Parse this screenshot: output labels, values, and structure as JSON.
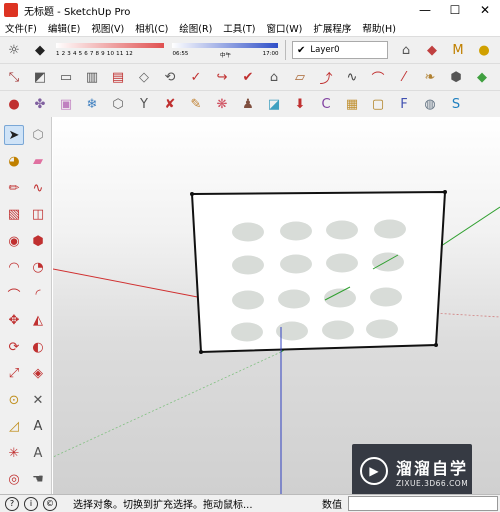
{
  "window": {
    "title": "无标题 - SketchUp Pro",
    "minimize": "—",
    "maximize": "☐",
    "close": "✕"
  },
  "menu": [
    "文件(F)",
    "编辑(E)",
    "视图(V)",
    "相机(C)",
    "绘图(R)",
    "工具(T)",
    "窗口(W)",
    "扩展程序",
    "帮助(H)"
  ],
  "shadow_settings": {
    "month_ticks": "1 2 3 4 5 6 7 8 9 10 11 12",
    "time_start": "06:55",
    "time_mid": "中午",
    "time_end": "17:00"
  },
  "layer": {
    "current": "Layer0",
    "check": "✔"
  },
  "toolbar_row1_icons": [
    {
      "name": "shadow-icon",
      "glyph": "☼",
      "color": "#333333"
    },
    {
      "name": "eraser-icon",
      "glyph": "◆",
      "color": "#222222"
    }
  ],
  "toolbar_row1_right_icons": [
    {
      "name": "warehouse-icon",
      "glyph": "⌂",
      "color": "#555555"
    },
    {
      "name": "share-model-icon",
      "glyph": "◆",
      "color": "#c04040"
    },
    {
      "name": "extension-warehouse-icon",
      "glyph": "M",
      "color": "#c08000"
    },
    {
      "name": "layout-icon",
      "glyph": "●",
      "color": "#d0a000"
    }
  ],
  "toolbar_row2_icons": [
    {
      "name": "move-vertex-icon",
      "glyph": "⤡",
      "color": "#a03030"
    },
    {
      "name": "push-face-icon",
      "glyph": "◩",
      "color": "#555555"
    },
    {
      "name": "offset-face-icon",
      "glyph": "▭",
      "color": "#555555"
    },
    {
      "name": "array-icon",
      "glyph": "▥",
      "color": "#555555"
    },
    {
      "name": "extrude-icon",
      "glyph": "▤",
      "color": "#c03030"
    },
    {
      "name": "slice-icon",
      "glyph": "◇",
      "color": "#666666"
    },
    {
      "name": "rotate-copy-icon",
      "glyph": "⟲",
      "color": "#555555"
    },
    {
      "name": "curve-icon",
      "glyph": "✓",
      "color": "#c03030"
    },
    {
      "name": "spline-icon",
      "glyph": "↪",
      "color": "#c03030"
    },
    {
      "name": "check-curve-icon",
      "glyph": "✔",
      "color": "#c03030"
    },
    {
      "name": "roof-icon",
      "glyph": "⌂",
      "color": "#555555"
    },
    {
      "name": "tape-icon",
      "glyph": "▱",
      "color": "#aa6633"
    },
    {
      "name": "bezier-icon",
      "glyph": "⤴",
      "color": "#c03030"
    },
    {
      "name": "polyline-icon",
      "glyph": "∿",
      "color": "#444444"
    },
    {
      "name": "arc-tool-icon",
      "glyph": "⌒",
      "color": "#c03030"
    },
    {
      "name": "divide-icon",
      "glyph": "⁄",
      "color": "#c03030"
    },
    {
      "name": "leaf-icon",
      "glyph": "❧",
      "color": "#b08030"
    },
    {
      "name": "solid-icon",
      "glyph": "⬢",
      "color": "#555555"
    },
    {
      "name": "terrain-icon",
      "glyph": "◆",
      "color": "#40a040"
    },
    {
      "name": "hand-icon",
      "glyph": "☚",
      "color": "#555555"
    }
  ],
  "toolbar_row3_icons": [
    {
      "name": "paint-red-icon",
      "glyph": "●",
      "color": "#c03030"
    },
    {
      "name": "molecule-icon",
      "glyph": "✤",
      "color": "#8060a0"
    },
    {
      "name": "cube-icon",
      "glyph": "▣",
      "color": "#c080c0"
    },
    {
      "name": "snowflake-icon",
      "glyph": "❄",
      "color": "#4080c0"
    },
    {
      "name": "wire-cube-icon",
      "glyph": "⬡",
      "color": "#666666"
    },
    {
      "name": "y-branch-icon",
      "glyph": "Y",
      "color": "#555555"
    },
    {
      "name": "cross-tool-icon",
      "glyph": "✘",
      "color": "#c03030"
    },
    {
      "name": "brush-icon",
      "glyph": "✎",
      "color": "#c08030"
    },
    {
      "name": "maple-leaf-icon",
      "glyph": "❋",
      "color": "#d05060"
    },
    {
      "name": "person-icon",
      "glyph": "♟",
      "color": "#805040"
    },
    {
      "name": "color-cube-icon",
      "glyph": "◪",
      "color": "#40a0c0"
    },
    {
      "name": "push-down-icon",
      "glyph": "⬇",
      "color": "#c03030"
    },
    {
      "name": "c3-icon",
      "glyph": "C",
      "color": "#8040a0"
    },
    {
      "name": "box-icon",
      "glyph": "▦",
      "color": "#c09030"
    },
    {
      "name": "frame-icon",
      "glyph": "▢",
      "color": "#b08020"
    },
    {
      "name": "f6-icon",
      "glyph": "F",
      "color": "#4050b0"
    },
    {
      "name": "ball-icon",
      "glyph": "◍",
      "color": "#607080"
    },
    {
      "name": "skin-icon",
      "glyph": "S",
      "color": "#2080c0"
    }
  ],
  "left_tools": [
    {
      "name": "select-arrow-icon",
      "glyph": "➤",
      "color": "#222222"
    },
    {
      "name": "component-icon",
      "glyph": "⬡",
      "color": "#888888"
    },
    {
      "name": "paint-bucket-icon",
      "glyph": "◕",
      "color": "#c08000"
    },
    {
      "name": "eraser-tool-icon",
      "glyph": "▰",
      "color": "#e070a0"
    },
    {
      "name": "pencil-icon",
      "glyph": "✏",
      "color": "#c03030"
    },
    {
      "name": "freehand-icon",
      "glyph": "∿",
      "color": "#c03030"
    },
    {
      "name": "rectangle-icon",
      "glyph": "▧",
      "color": "#c03030"
    },
    {
      "name": "rotated-rect-icon",
      "glyph": "◫",
      "color": "#c03030"
    },
    {
      "name": "circle-icon",
      "glyph": "◉",
      "color": "#c03030"
    },
    {
      "name": "polygon-icon",
      "glyph": "⬢",
      "color": "#c03030"
    },
    {
      "name": "arc-icon",
      "glyph": "◠",
      "color": "#c03030"
    },
    {
      "name": "pie-icon",
      "glyph": "◔",
      "color": "#c03030"
    },
    {
      "name": "arc-3pt-icon",
      "glyph": "⌒",
      "color": "#c03030"
    },
    {
      "name": "arc-2pt-icon",
      "glyph": "◜",
      "color": "#c03030"
    },
    {
      "name": "move-icon",
      "glyph": "✥",
      "color": "#c03030"
    },
    {
      "name": "push-pull-icon",
      "glyph": "◭",
      "color": "#c03030"
    },
    {
      "name": "rotate-icon",
      "glyph": "⟳",
      "color": "#c03030"
    },
    {
      "name": "follow-me-icon",
      "glyph": "◐",
      "color": "#c03030"
    },
    {
      "name": "scale-icon",
      "glyph": "⤢",
      "color": "#c03030"
    },
    {
      "name": "offset-icon",
      "glyph": "◈",
      "color": "#c03030"
    },
    {
      "name": "tape-measure-icon",
      "glyph": "⊙",
      "color": "#c09020"
    },
    {
      "name": "dimension-icon",
      "glyph": "✕",
      "color": "#555555"
    },
    {
      "name": "protractor-icon",
      "glyph": "◿",
      "color": "#c09020"
    },
    {
      "name": "text-icon",
      "glyph": "A",
      "color": "#444444"
    },
    {
      "name": "axes-icon",
      "glyph": "✳",
      "color": "#c03030"
    },
    {
      "name": "3d-text-icon",
      "glyph": "A",
      "color": "#555555"
    },
    {
      "name": "orbit-icon",
      "glyph": "◎",
      "color": "#c03030"
    },
    {
      "name": "pan-icon",
      "glyph": "☚",
      "color": "#555555"
    }
  ],
  "status": {
    "message": "选择对象。切换到扩充选择。拖动鼠标...",
    "value_label": "数值",
    "value": "",
    "icon_1": "?",
    "icon_2": "i",
    "icon_3": "©"
  },
  "watermark": {
    "main": "溜溜自学",
    "sub": "ZIXUE.3D66.COM"
  }
}
